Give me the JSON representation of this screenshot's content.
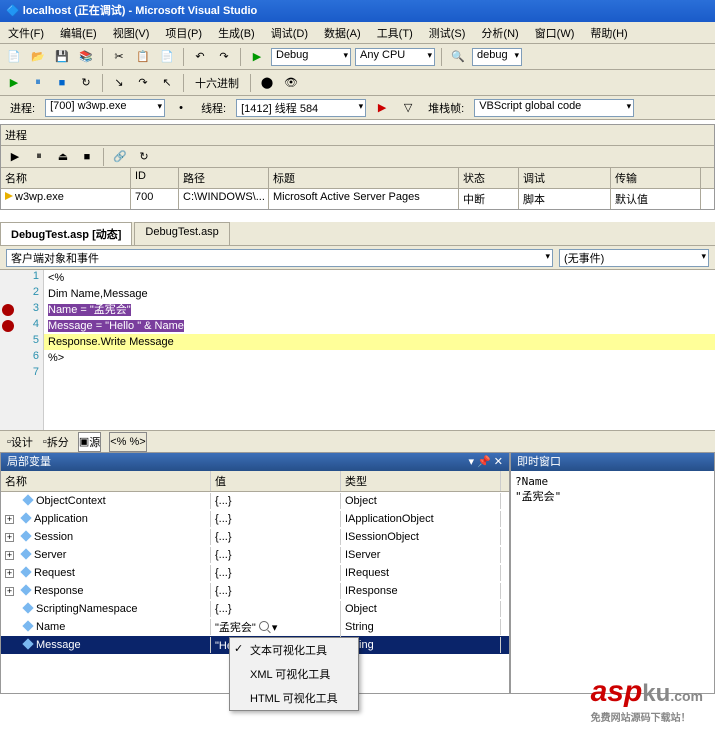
{
  "title": "localhost (正在调试) - Microsoft Visual Studio",
  "menu": [
    "文件(F)",
    "编辑(E)",
    "视图(V)",
    "项目(P)",
    "生成(B)",
    "调试(D)",
    "数据(A)",
    "工具(T)",
    "测试(S)",
    "分析(N)",
    "窗口(W)",
    "帮助(H)"
  ],
  "toolbar1": {
    "config": "Debug",
    "platform": "Any CPU",
    "search": "debug"
  },
  "toolbar2": {
    "hex": "十六进制"
  },
  "processBar": {
    "procLabel": "进程:",
    "proc": "[700] w3wp.exe",
    "threadLabel": "线程:",
    "thread": "[1412] 线程 584",
    "stackLabel": "堆栈帧:",
    "stack": "VBScript global code"
  },
  "procPanel": {
    "title": "进程",
    "headers": [
      "名称",
      "ID",
      "路径",
      "标题",
      "状态",
      "调试",
      "传输"
    ],
    "row": [
      "w3wp.exe",
      "700",
      "C:\\WINDOWS\\...",
      "Microsoft Active Server Pages",
      "中断",
      "脚本",
      "默认值"
    ]
  },
  "editorTabs": {
    "active": "DebugTest.asp [动态]",
    "other": "DebugTest.asp"
  },
  "editorDropdowns": {
    "left": "客户端对象和事件",
    "right": "(无事件)"
  },
  "code": {
    "lines": [
      "<%",
      "Dim Name,Message",
      "Name = \"孟宪会\"",
      "Message = \"Hello \" & Name",
      "Response.Write Message",
      "%>",
      ""
    ],
    "breakpoints": [
      3,
      4
    ],
    "currentLine": 5
  },
  "bottomTabs": {
    "design": "设计",
    "split": "拆分",
    "source": "源",
    "ext": "<% %>"
  },
  "localsPanel": {
    "title": "局部变量",
    "headers": [
      "名称",
      "值",
      "类型"
    ],
    "rows": [
      {
        "name": "ObjectContext",
        "value": "{...}",
        "type": "Object",
        "expand": false
      },
      {
        "name": "Application",
        "value": "{...}",
        "type": "IApplicationObject",
        "expand": true
      },
      {
        "name": "Session",
        "value": "{...}",
        "type": "ISessionObject",
        "expand": true
      },
      {
        "name": "Server",
        "value": "{...}",
        "type": "IServer",
        "expand": true
      },
      {
        "name": "Request",
        "value": "{...}",
        "type": "IRequest",
        "expand": true
      },
      {
        "name": "Response",
        "value": "{...}",
        "type": "IResponse",
        "expand": true
      },
      {
        "name": "ScriptingNamespace",
        "value": "{...}",
        "type": "Object",
        "expand": false
      },
      {
        "name": "Name",
        "value": "\"孟宪会\"",
        "type": "String",
        "expand": false
      },
      {
        "name": "Message",
        "value": "\"Hello 孟宪会\"",
        "type": "String",
        "expand": false,
        "selected": true
      }
    ]
  },
  "contextMenu": [
    "文本可视化工具",
    "XML 可视化工具",
    "HTML 可视化工具"
  ],
  "immediatePanel": {
    "title": "即时窗口",
    "content": "?Name\n\"孟宪会\""
  },
  "logo": {
    "asp": "asp",
    "ku": "ku",
    "com": ".com",
    "tagline": "免费网站源码下载站！"
  }
}
